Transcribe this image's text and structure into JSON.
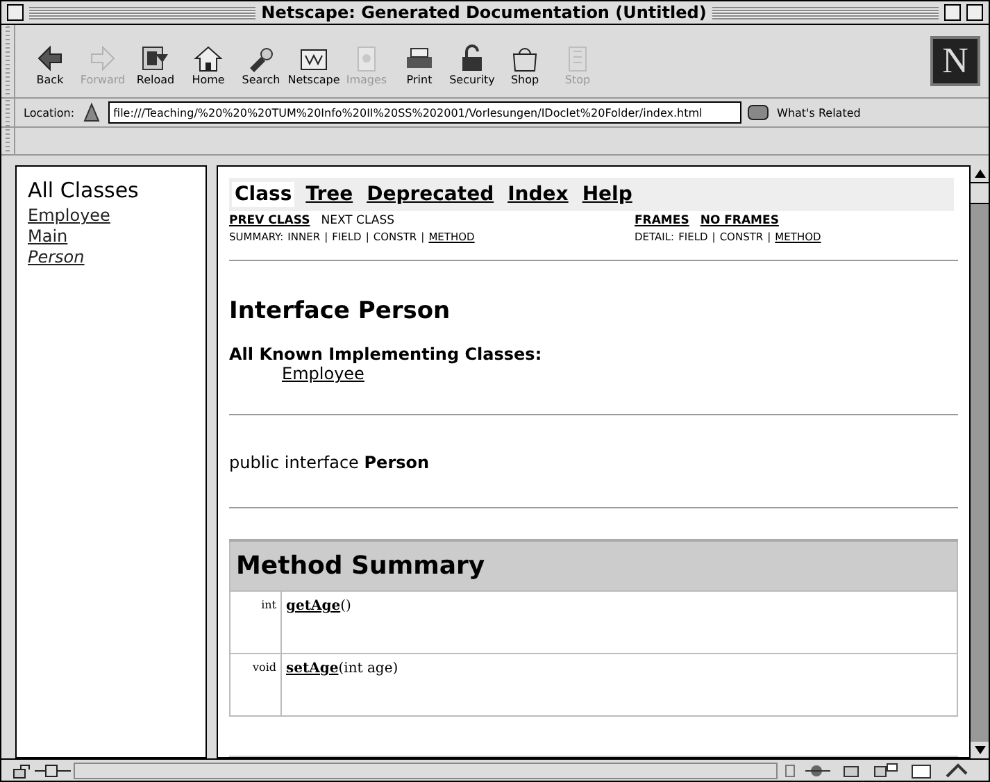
{
  "window": {
    "title": "Netscape: Generated Documentation (Untitled)"
  },
  "toolbar": [
    {
      "label": "Back",
      "disabled": false
    },
    {
      "label": "Forward",
      "disabled": true
    },
    {
      "label": "Reload",
      "disabled": false
    },
    {
      "label": "Home",
      "disabled": false
    },
    {
      "label": "Search",
      "disabled": false
    },
    {
      "label": "Netscape",
      "disabled": false
    },
    {
      "label": "Images",
      "disabled": true
    },
    {
      "label": "Print",
      "disabled": false
    },
    {
      "label": "Security",
      "disabled": false
    },
    {
      "label": "Shop",
      "disabled": false
    },
    {
      "label": "Stop",
      "disabled": true
    }
  ],
  "logo": "N",
  "progress": {
    "level": 0
  },
  "location": {
    "label": "Location:",
    "value": "file:///Teaching/%20%20%20TUM%20Info%20II%20SS%202001/Vorlesungen/IDoclet%20Folder/index.html"
  },
  "whats_related": "What's Related",
  "left_frame": {
    "heading": "All Classes",
    "items": [
      {
        "label": "Employee",
        "kind": "class"
      },
      {
        "label": "Main",
        "kind": "class"
      },
      {
        "label": "Person",
        "kind": "interface"
      }
    ]
  },
  "nav_tabs": [
    {
      "label": "Class",
      "selected": true
    },
    {
      "label": "Tree",
      "selected": false
    },
    {
      "label": "Deprecated",
      "selected": false
    },
    {
      "label": "Index",
      "selected": false
    },
    {
      "label": "Help",
      "selected": false
    }
  ],
  "class_links": [
    {
      "label": "PREV CLASS",
      "link": true
    },
    {
      "label": "NEXT CLASS",
      "link": false
    }
  ],
  "frame_links": [
    {
      "label": "FRAMES",
      "link": true
    },
    {
      "label": "NO FRAMES",
      "link": true
    }
  ],
  "summary": {
    "label": "SUMMARY:",
    "separator": "|",
    "items": [
      {
        "label": "INNER",
        "link": false
      },
      {
        "label": "FIELD",
        "link": false
      },
      {
        "label": "CONSTR",
        "link": false
      },
      {
        "label": "METHOD",
        "link": true
      }
    ]
  },
  "detail": {
    "label": "DETAIL:",
    "separator": "|",
    "items": [
      {
        "label": "FIELD",
        "link": false
      },
      {
        "label": "CONSTR",
        "link": false
      },
      {
        "label": "METHOD",
        "link": true
      }
    ]
  },
  "title": "Interface Person",
  "implementing": {
    "heading": "All Known Implementing Classes:",
    "classes": [
      "Employee"
    ]
  },
  "declaration": "public interface **Person**",
  "method_summary": {
    "heading": "Method Summary",
    "rows": [
      {
        "type": "int",
        "name": "getAge",
        "params": "()"
      },
      {
        "type": "void",
        "name": "setAge",
        "params": "(int age)"
      }
    ]
  }
}
